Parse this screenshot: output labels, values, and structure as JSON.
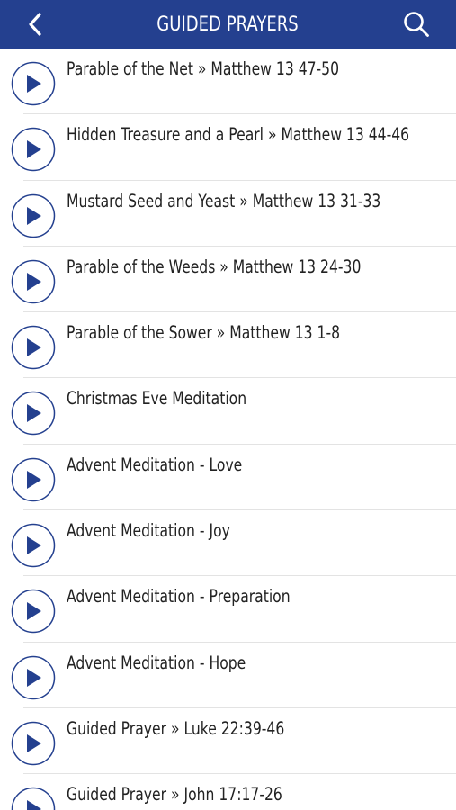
{
  "header": {
    "title": "GUIDED PRAYERS",
    "back_icon": "chevron-left-icon",
    "search_icon": "search-icon",
    "background_color": "#24408f"
  },
  "prayers": [
    {
      "label": "Parable of the Net » Matthew 13 47-50"
    },
    {
      "label": "Hidden Treasure and a Pearl » Matthew 13 44-46"
    },
    {
      "label": "Mustard Seed and Yeast » Matthew 13 31-33"
    },
    {
      "label": "Parable of the Weeds » Matthew 13 24-30"
    },
    {
      "label": "Parable of the Sower » Matthew 13 1-8"
    },
    {
      "label": "Christmas Eve Meditation"
    },
    {
      "label": "Advent Meditation - Love"
    },
    {
      "label": "Advent Meditation - Joy"
    },
    {
      "label": "Advent Meditation - Preparation"
    },
    {
      "label": "Advent Meditation - Hope"
    },
    {
      "label": "Guided Prayer » Luke 22:39-46"
    },
    {
      "label": "Guided Prayer » John 17:17-26"
    }
  ],
  "icons": {
    "row_icon": "play-circle-icon"
  },
  "colors": {
    "accent": "#24408f",
    "text": "#222222",
    "divider": "#e3e3e3"
  }
}
